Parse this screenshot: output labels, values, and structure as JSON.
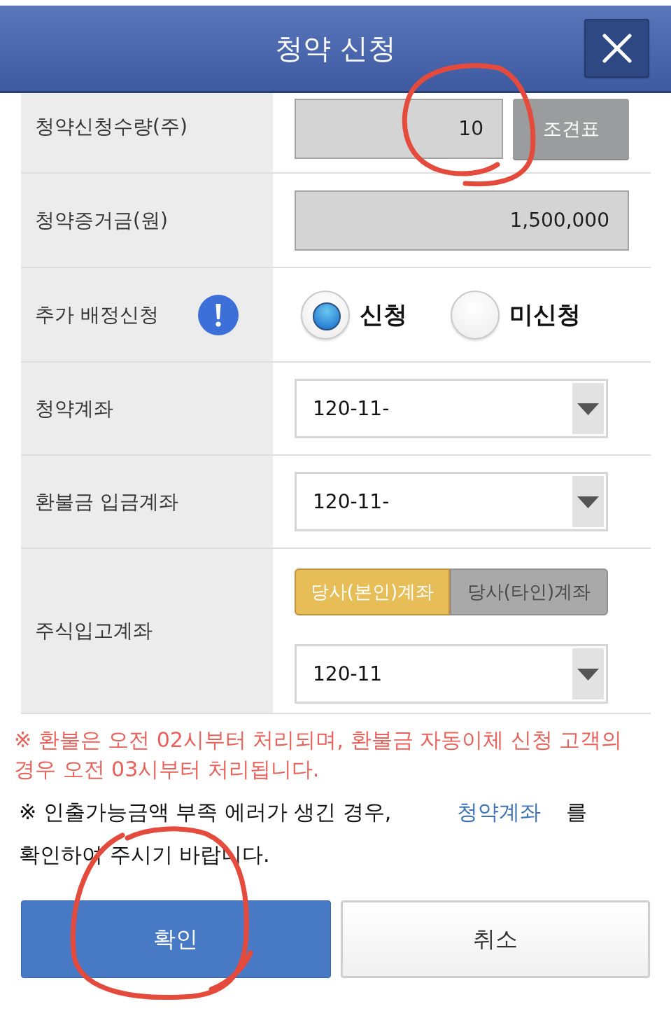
{
  "dialog": {
    "title": "청약 신청"
  },
  "form": {
    "rows": [
      {
        "kind": "quantity",
        "label": "청약신청수량(주)",
        "info_icon": false,
        "circled": true,
        "value": "10",
        "button": "조견표"
      },
      {
        "kind": "amount",
        "label": "청약증거금(원)",
        "info_icon": false,
        "circled": false,
        "value": "1,500,000"
      },
      {
        "kind": "radio",
        "label": "추가 배정신청",
        "info_icon": true,
        "circled": false,
        "options": [
          {
            "label": "신청",
            "selected": true
          },
          {
            "label": "미신청",
            "selected": false
          }
        ]
      },
      {
        "kind": "select",
        "label": "청약계좌",
        "info_icon": false,
        "circled": false,
        "value": "120-11-"
      },
      {
        "kind": "select",
        "label": "환불금 입금계좌",
        "info_icon": false,
        "circled": false,
        "value": "120-11-"
      },
      {
        "kind": "account_choice",
        "label": "주식입고계좌",
        "info_icon": false,
        "circled": false,
        "options": [
          {
            "label": "당사(본인)계좌",
            "selected": true
          },
          {
            "label": "당사(타인)계좌",
            "selected": false
          }
        ],
        "value": "120-11"
      }
    ]
  },
  "notes": [
    {
      "kind": "warning",
      "text": "※ 환불은 오전 02시부터 처리되며, 환불금 자동이체 신청 고객의 경우 오전 03시부터 처리됩니다."
    },
    {
      "kind": "info",
      "text_before": "※ 인출가능금액 부족 에러가 생긴 경우,",
      "link": "청약계좌",
      "text_after": "를 확인하여 주시기 바랍니다."
    }
  ],
  "buttons": [
    {
      "kind": "primary",
      "label": "확인",
      "circled": true
    },
    {
      "kind": "secondary",
      "label": "취소",
      "circled": false
    }
  ]
}
